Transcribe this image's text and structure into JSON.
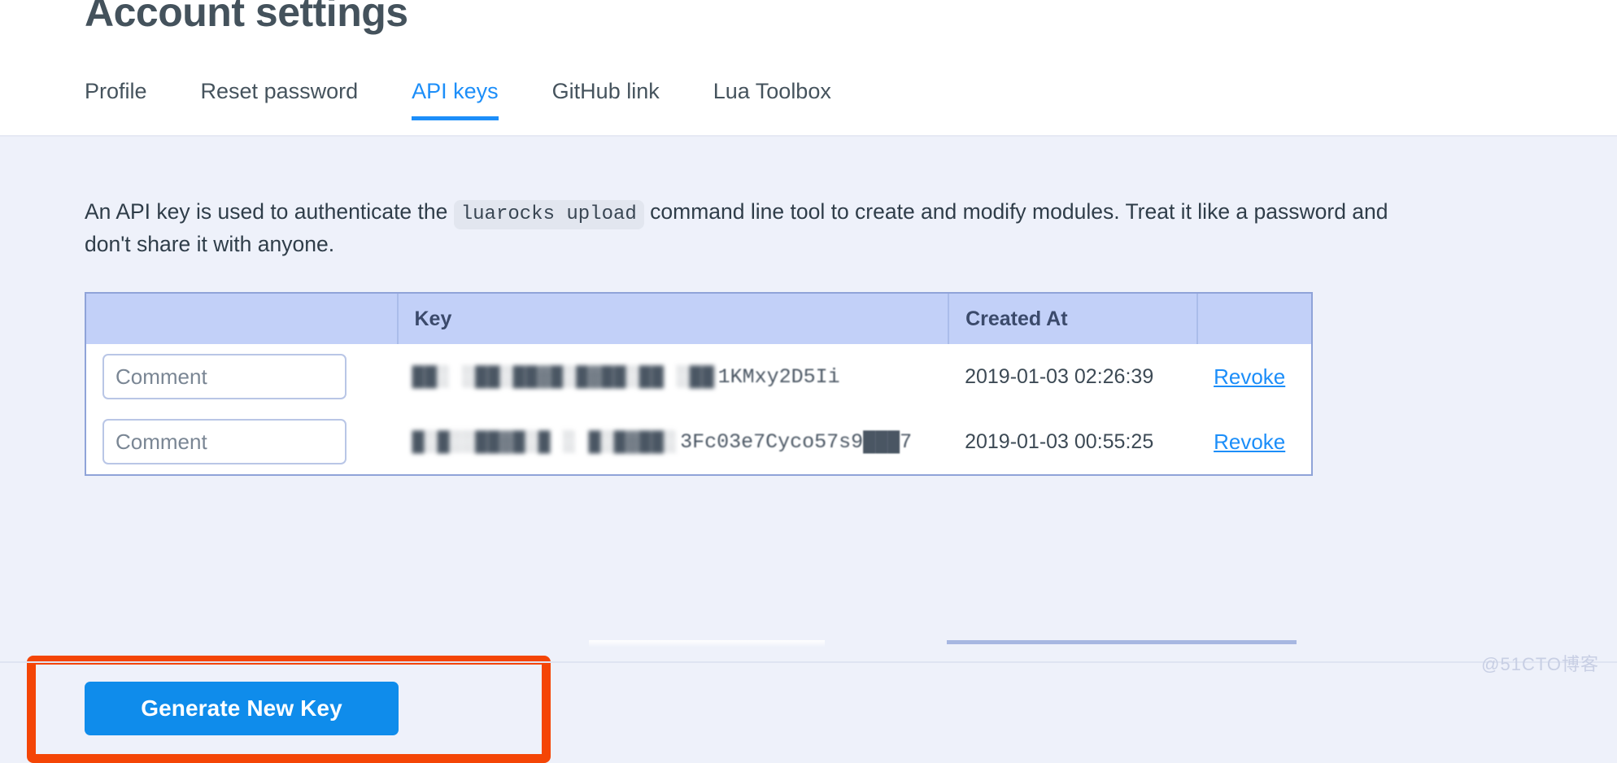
{
  "page": {
    "title": "Account settings",
    "background_color": "#eef1fa",
    "accent_color": "#1c8ef9",
    "highlight_color": "#f44506"
  },
  "tabs": [
    {
      "label": "Profile",
      "active": false
    },
    {
      "label": "Reset password",
      "active": false
    },
    {
      "label": "API keys",
      "active": true
    },
    {
      "label": "GitHub link",
      "active": false
    },
    {
      "label": "Lua Toolbox",
      "active": false
    }
  ],
  "intro": {
    "before_code": "An API key is used to authenticate the ",
    "code": "luarocks upload",
    "after_code": " command line tool to create and modify modules. Treat it like a password and don't share it with anyone."
  },
  "table": {
    "columns": [
      "",
      "Key",
      "Created At",
      ""
    ],
    "rows": [
      {
        "comment_value": "",
        "comment_placeholder": "Comment",
        "key_masked": "██░ ░██░██▓█░█▓██░██ ░██",
        "key_tail": "1KMxy2D5Ii",
        "created_at": "2019-01-03 02:26:39",
        "action_label": "Revoke"
      },
      {
        "comment_value": "",
        "comment_placeholder": "Comment",
        "key_masked": "█░█░░██▓█░█ ░ █░█▓██░",
        "key_tail": "3Fc03e7Cyco57s9███7",
        "created_at": "2019-01-03 00:55:25",
        "action_label": "Revoke"
      }
    ]
  },
  "actions": {
    "generate_key_label": "Generate New Key"
  },
  "watermark": {
    "text": "@51CTO博客"
  }
}
